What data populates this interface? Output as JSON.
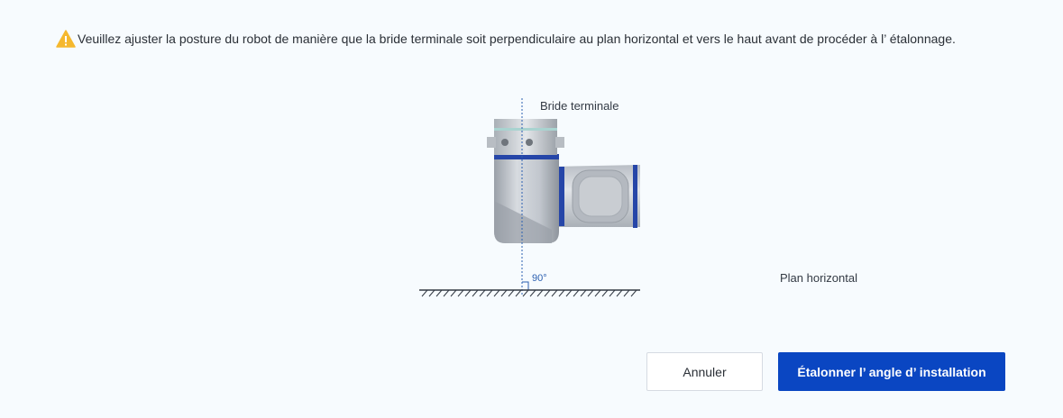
{
  "notice": {
    "icon": "warning-icon",
    "text": "Veuillez ajuster la posture du robot de manière que la bride terminale soit perpendiculaire au plan horizontal et vers le haut avant de procéder à l’ étalonnage."
  },
  "diagram": {
    "bride_label": "Bride terminale",
    "plane_label": "Plan horizontal",
    "angle_label": "90°"
  },
  "actions": {
    "cancel_label": "Annuler",
    "calibrate_label": "Étalonner l’ angle d’ installation"
  },
  "colors": {
    "background": "#f7fbfe",
    "primary": "#0a46c2",
    "warning": "#f5b82e",
    "robot_band": "#2646a8",
    "guide_line": "#2b5fb0"
  }
}
